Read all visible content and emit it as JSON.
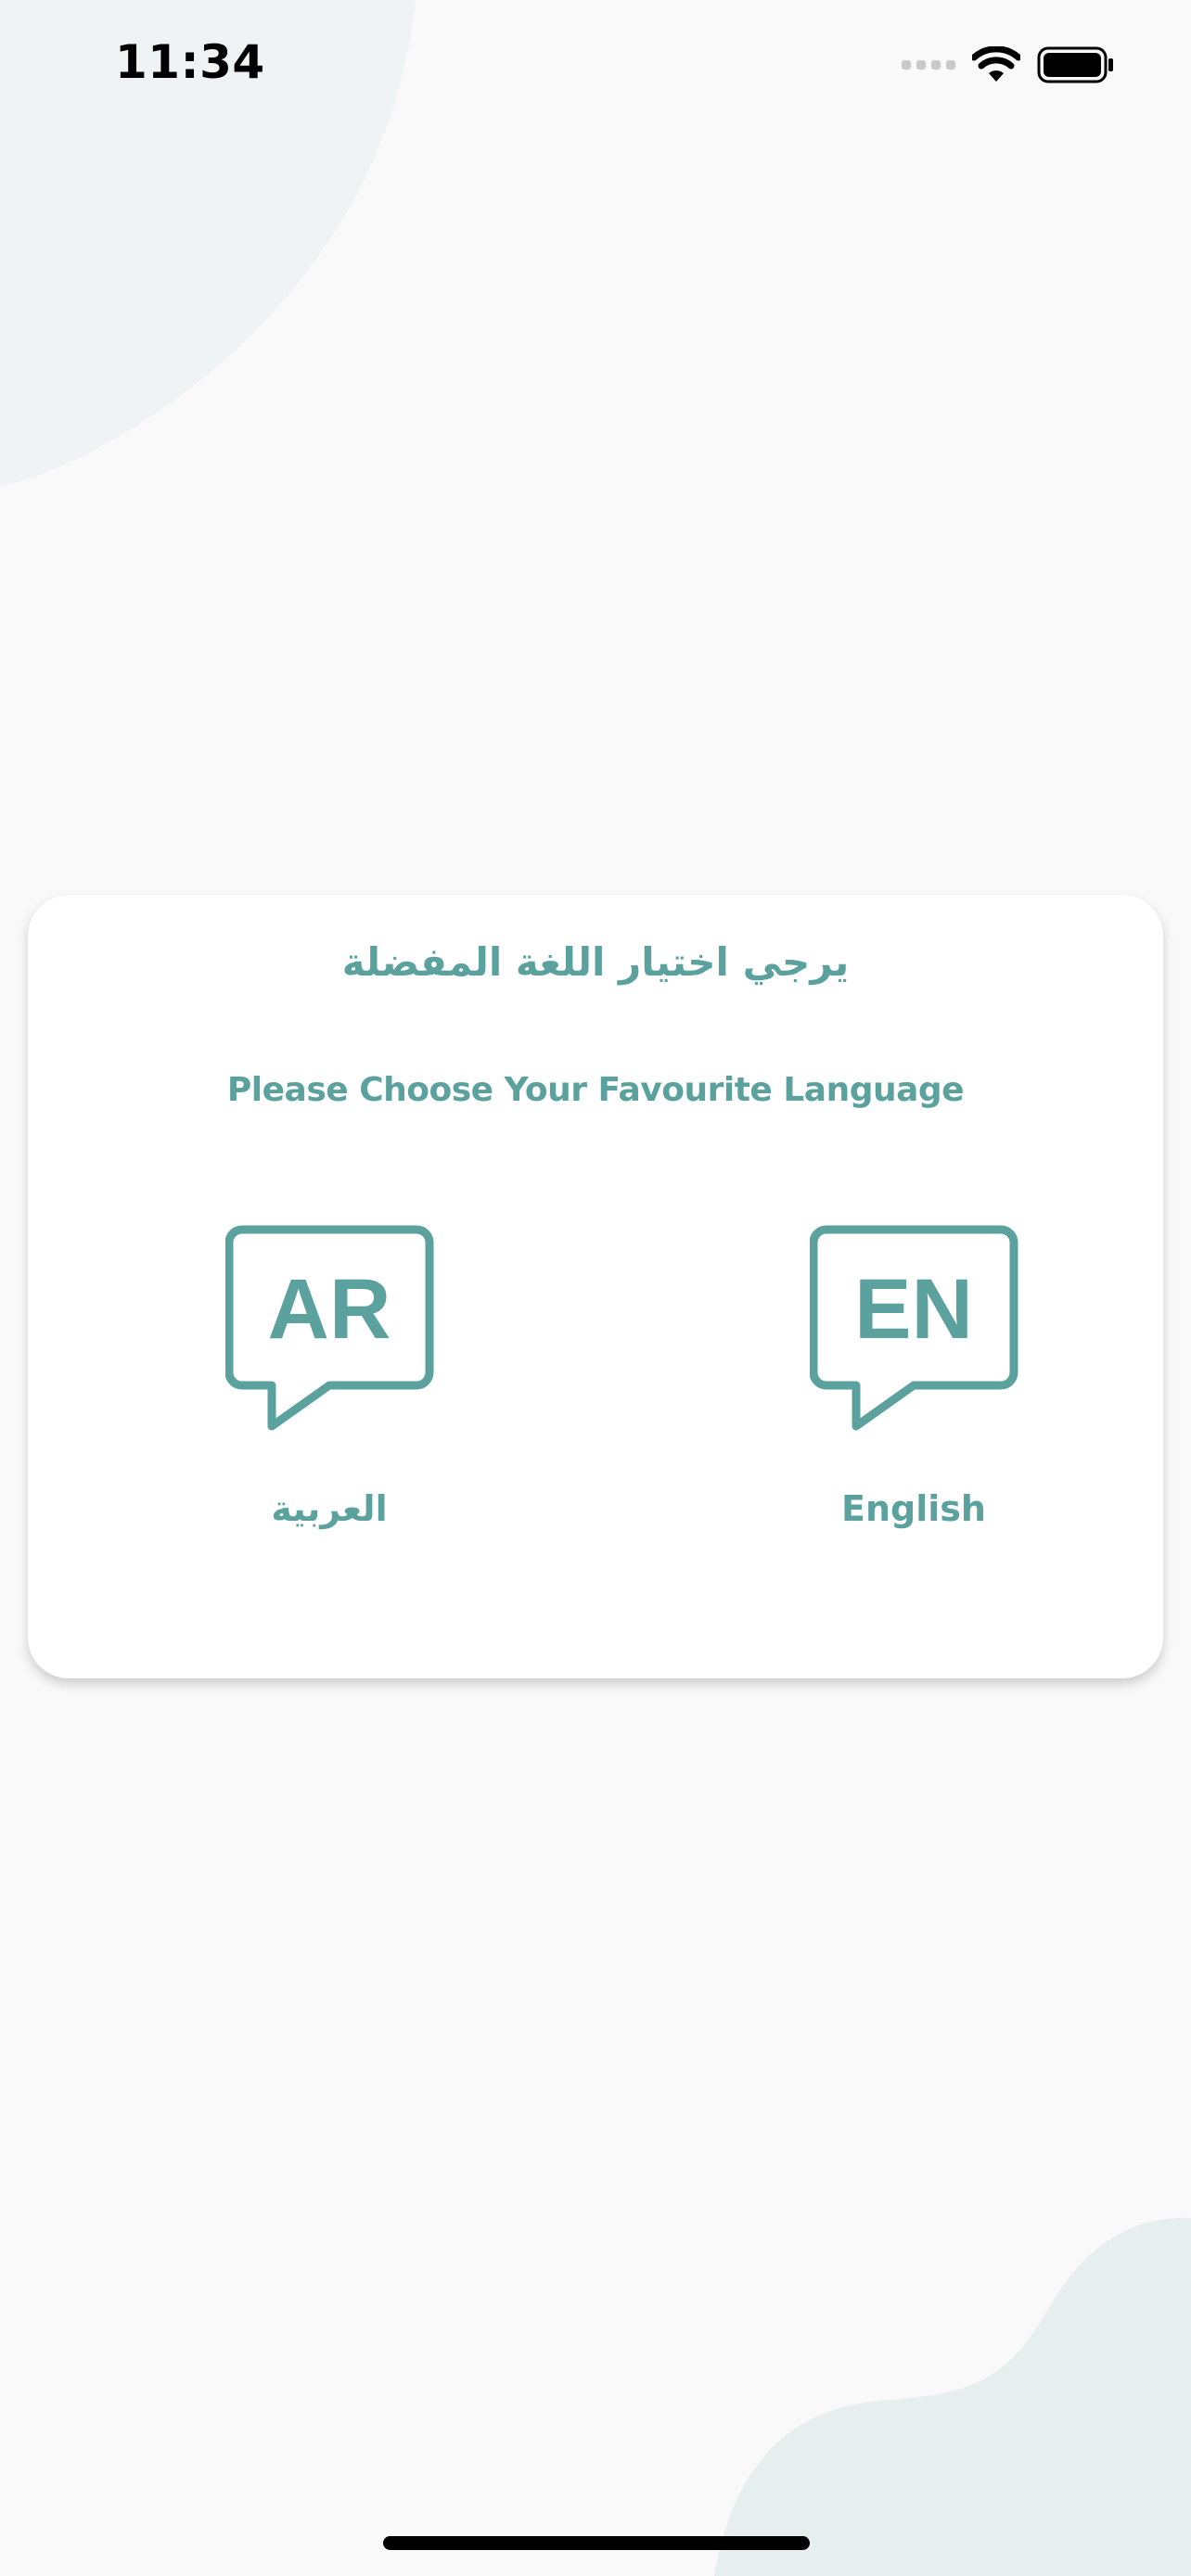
{
  "status_bar": {
    "time": "11:34"
  },
  "card": {
    "title_ar": "يرجي اختيار اللغة المفضلة",
    "title_en": "Please Choose Your Favourite Language",
    "options": [
      {
        "code": "AR",
        "label": "العربية"
      },
      {
        "code": "EN",
        "label": "English"
      }
    ]
  },
  "colors": {
    "accent": "#5ba19e",
    "background": "#f9f9f9",
    "blob": "#e6efee",
    "card": "#ffffff"
  }
}
